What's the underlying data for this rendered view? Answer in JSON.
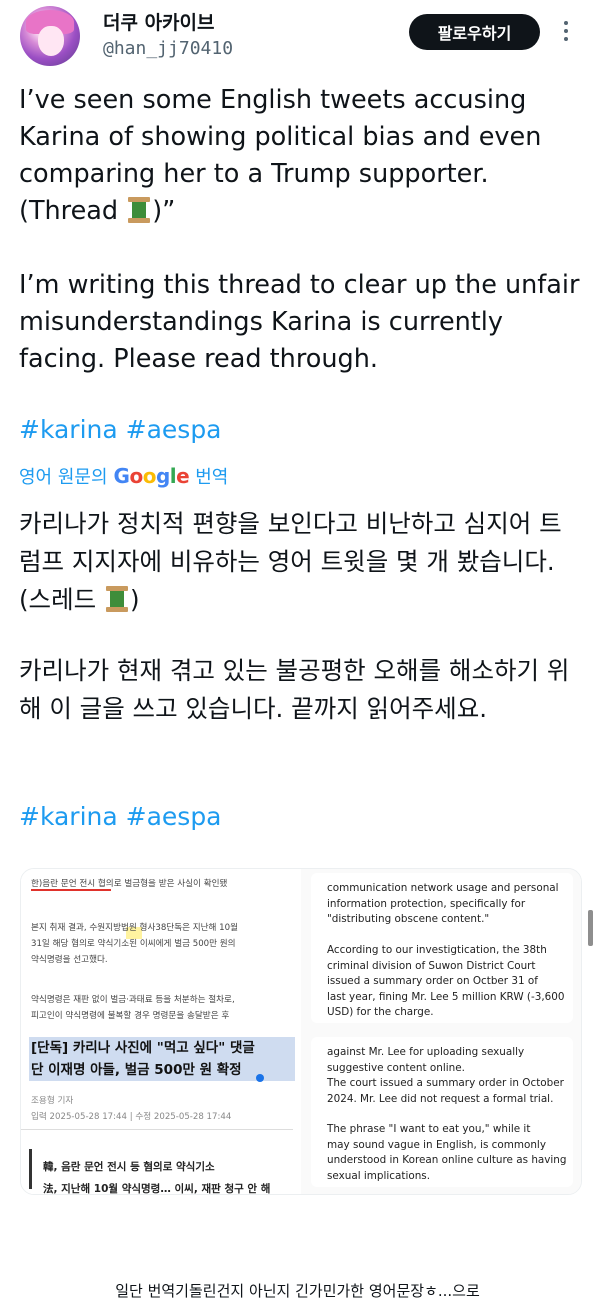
{
  "header": {
    "display_name": "더쿠 아카이브",
    "handle": "@han_jj70410",
    "follow_label": "팔로우하기"
  },
  "tweet": {
    "para1": "I’ve seen some English tweets accusing Karina of showing political bias and even comparing her to a Trump supporter. (Thread ",
    "para1_end": ")”",
    "para2": "I’m writing this thread to clear up the unfair misunderstandings Karina is currently facing. Please read through.",
    "hashtags": "#karina #aespa",
    "translate_prefix": "영어 원문의",
    "translate_brand": "Google",
    "translate_suffix": "번역",
    "kpara1": "카리나가 정치적 편향을 보인다고 비난하고 심지어 트럼프 지지자에 비유하는 영어 트윗을 몇 개 봤습니다. (스레드 ",
    "kpara1_end": ")",
    "kpara2": "카리나가 현재 겪고 있는 불공평한 오해를 해소하기 위해 이 글을 쓰고 있습니다. 끝까지 읽어주세요.",
    "hashtags_2": "#karina #aespa"
  },
  "media": {
    "left": {
      "line1": "한)음란 문언 전시 협의로 벌금형을 받은 사실이 확인됐",
      "line2": "본지 취재 결과, 수원지방법원 형사38단독은 지난해 10월",
      "line3": "31일 해당 혐의로 약식기소된 이씨에게 벌금 500만 원의",
      "line4": "약식명령을 선고했다.",
      "line5": "약식명령은 재판 없이 벌금·과태료 등을 처분하는 절차로,",
      "line6": "피고인이 약식명령에 불복할 경우 명령문을 송달받은 후",
      "headline1": "[단독] 카리나 사진에 \"먹고 싶다\" 댓글",
      "headline2": "단 이재명 아들, 벌금 500만 원 확정",
      "reporter": "조용형 기자",
      "dates": "입력 2025-05-28 17:44 | 수정 2025-05-28 17:44",
      "related1": "韓, 음란 문언 전시 등 혐의로 약식기소",
      "related2": "法, 지난해 10월 약식명령… 이씨, 재판 청구 안 해"
    },
    "right": {
      "line1": "communication network usage and personal",
      "line2": "information protection, specifically for",
      "line3": "\"distributing obscene content.\"",
      "line4": "According to our investigtication, the 38th",
      "line5": "criminal division of Suwon District Court",
      "line6": "issued a summary order on Octber 31 of",
      "line7": "last year, fining Mr. Lee 5 million KRW (-3,600",
      "line8": "USD) for the charge.",
      "line9": "against Mr. Lee for uploading sexually",
      "line10": "suggestive content online.",
      "line11": "The court issued a summary order in October",
      "line12": "2024. Mr. Lee did not request a formal trial.",
      "line13": "The phrase \"I want to eat you,\" while it",
      "line14": "may sound vague in English, is commonly",
      "line15": "understood in Korean online culture as having",
      "line16": "sexual implications."
    }
  },
  "caption": "일단 번역기돌린건지 아닌지 긴가민가한 영어문장ㅎ...으로"
}
